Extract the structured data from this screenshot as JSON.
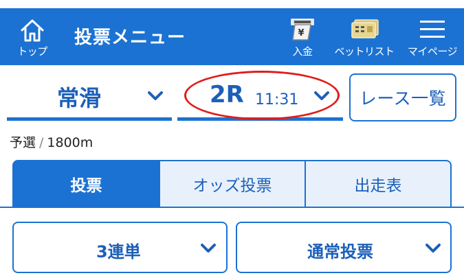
{
  "header": {
    "title": "投票メニュー",
    "home_label": "トップ",
    "deposit_label": "入金",
    "betlist_label": "ベットリスト",
    "mypage_label": "マイページ",
    "deposit_symbol": "¥"
  },
  "race": {
    "venue": "常滑",
    "number": "2R",
    "time": "11:31",
    "list_button": "レース一覧",
    "grade": "予選",
    "separator": "/",
    "distance": "1800m"
  },
  "tabs": [
    {
      "label": "投票",
      "active": true
    },
    {
      "label": "オッズ投票",
      "active": false
    },
    {
      "label": "出走表",
      "active": false
    }
  ],
  "bet": {
    "type": "3連単",
    "method": "通常投票"
  },
  "colors": {
    "accent": "#1c72d2",
    "highlight": "#e01c1c"
  }
}
